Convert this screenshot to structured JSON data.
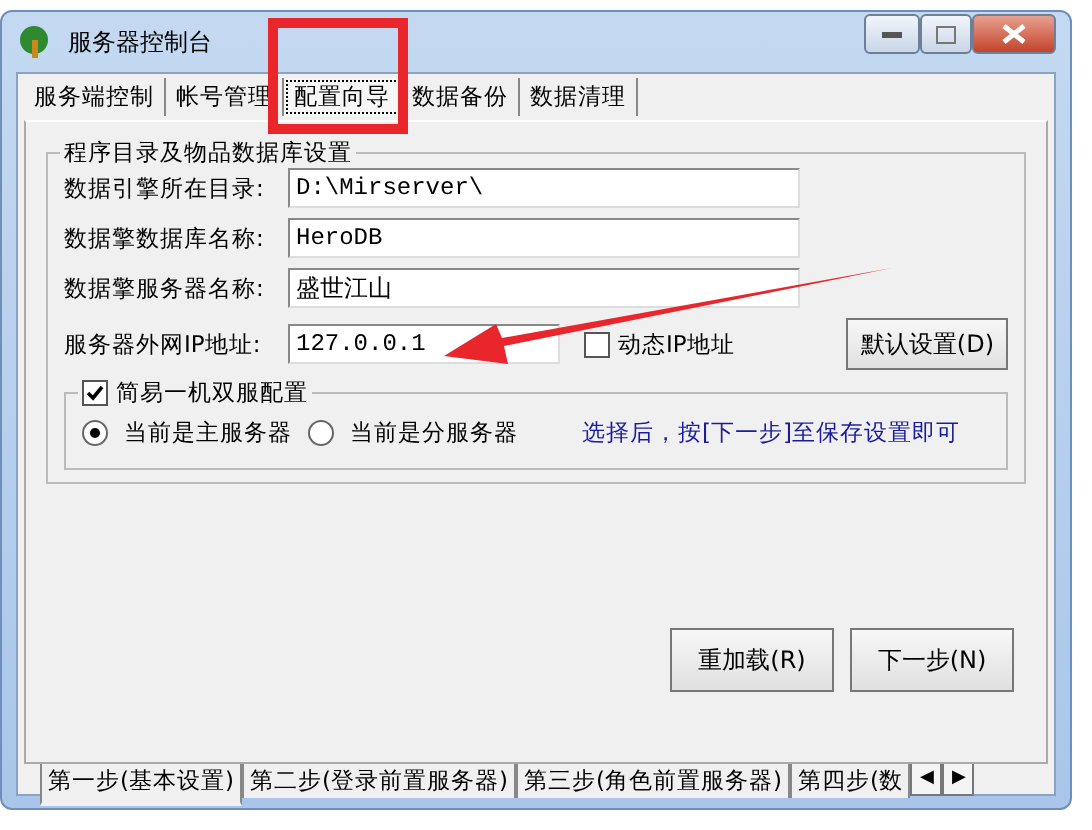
{
  "window": {
    "title": "服务器控制台"
  },
  "tabs": [
    {
      "label": "服务端控制",
      "selected": false
    },
    {
      "label": "帐号管理",
      "selected": false
    },
    {
      "label": "配置向导",
      "selected": true
    },
    {
      "label": "数据备份",
      "selected": false
    },
    {
      "label": "数据清理",
      "selected": false
    }
  ],
  "group": {
    "title": "程序目录及物品数据库设置",
    "fields": [
      {
        "label": "数据引擎所在目录:",
        "value": "D:\\Mirserver\\"
      },
      {
        "label": "数据擎数据库名称:",
        "value": "HeroDB"
      },
      {
        "label": "数据擎服务器名称:",
        "value": "盛世江山"
      },
      {
        "label": "服务器外网IP地址:",
        "value": "127.0.0.1"
      }
    ],
    "dynamic_ip": {
      "label": "动态IP地址",
      "checked": false
    },
    "default_button": "默认设置(D)",
    "dual": {
      "label": "简易一机双服配置",
      "checked": true,
      "radios": [
        {
          "label": "当前是主服务器",
          "selected": true
        },
        {
          "label": "当前是分服务器",
          "selected": false
        }
      ],
      "hint": "选择后，按[下一步]至保存设置即可"
    }
  },
  "buttons": [
    "重加载(R)",
    "下一步(N)"
  ],
  "step_tabs": [
    {
      "label": "第一步(基本设置)",
      "selected": true
    },
    {
      "label": "第二步(登录前置服务器)",
      "selected": false
    },
    {
      "label": "第三步(角色前置服务器)",
      "selected": false
    },
    {
      "label": "第四步(数",
      "selected": false
    }
  ],
  "scroll_arrows": [
    "◀",
    "▶"
  ],
  "annotations": {
    "highlight_box": true,
    "pointer_arrow": true
  }
}
